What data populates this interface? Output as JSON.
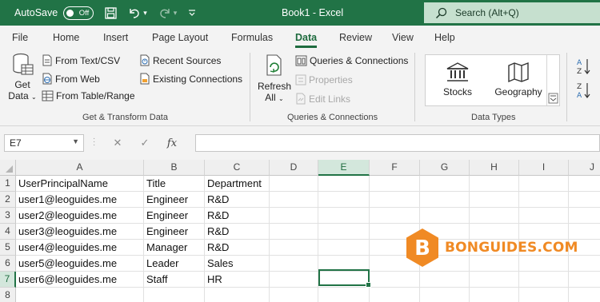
{
  "titlebar": {
    "autosave_label": "AutoSave",
    "autosave_state": "Off",
    "document_title": "Book1 - Excel",
    "search_placeholder": "Search (Alt+Q)"
  },
  "tabs": [
    {
      "label": "File"
    },
    {
      "label": "Home"
    },
    {
      "label": "Insert"
    },
    {
      "label": "Page Layout"
    },
    {
      "label": "Formulas"
    },
    {
      "label": "Data",
      "active": true
    },
    {
      "label": "Review"
    },
    {
      "label": "View"
    },
    {
      "label": "Help"
    }
  ],
  "ribbon": {
    "get_transform": {
      "get_data_line1": "Get",
      "get_data_line2": "Data",
      "from_text_csv": "From Text/CSV",
      "from_web": "From Web",
      "from_table_range": "From Table/Range",
      "recent_sources": "Recent Sources",
      "existing_connections": "Existing Connections",
      "group_label": "Get & Transform Data"
    },
    "queries": {
      "refresh_line1": "Refresh",
      "refresh_line2": "All",
      "queries_connections": "Queries & Connections",
      "properties": "Properties",
      "edit_links": "Edit Links",
      "group_label": "Queries & Connections"
    },
    "data_types": {
      "stocks": "Stocks",
      "geography": "Geography",
      "group_label": "Data Types"
    }
  },
  "formula_bar": {
    "name_box": "E7",
    "fx_label": "fx",
    "formula": ""
  },
  "columns": [
    "A",
    "B",
    "C",
    "D",
    "E",
    "F",
    "G",
    "H",
    "I",
    "J"
  ],
  "selected_column": "E",
  "rows": [
    "1",
    "2",
    "3",
    "4",
    "5",
    "6",
    "7",
    "8"
  ],
  "selected_row": "7",
  "cells": [
    [
      "UserPrincipalName",
      "Title",
      "Department"
    ],
    [
      "user1@leoguides.me",
      "Engineer",
      "R&D"
    ],
    [
      "user2@leoguides.me",
      "Engineer",
      "R&D"
    ],
    [
      "user3@leoguides.me",
      "Engineer",
      "R&D"
    ],
    [
      "user4@leoguides.me",
      "Manager",
      "R&D"
    ],
    [
      "user5@leoguides.me",
      "Leader",
      "Sales"
    ],
    [
      "user6@leoguides.me",
      "Staff",
      "HR"
    ],
    [
      "",
      "",
      ""
    ]
  ],
  "watermark": {
    "logo_letter": "B",
    "text": "BONGUIDES.COM"
  },
  "colors": {
    "excel_green": "#217346",
    "ribbon_bg": "#f3f3f3",
    "watermark_orange": "#f08a24"
  }
}
